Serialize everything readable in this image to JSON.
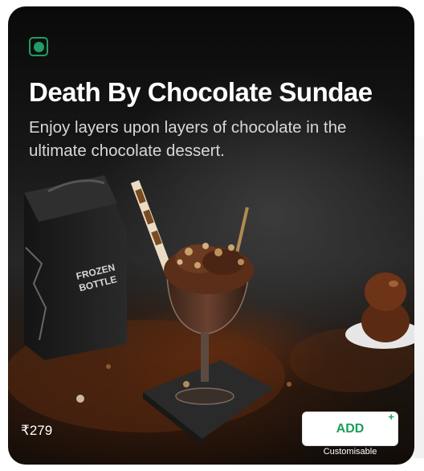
{
  "product": {
    "title": "Death By Chocolate Sundae",
    "description": "Enjoy layers upon layers of chocolate in the ultimate chocolate dessert.",
    "price": "₹279",
    "diet": "veg",
    "box_text_line1": "FROZEN",
    "box_text_line2": "BOTTLE"
  },
  "actions": {
    "add_label": "ADD",
    "plus_symbol": "+",
    "customisable_label": "Customisable"
  },
  "colors": {
    "veg_green": "#1f9d63",
    "add_green": "#1b9f5a"
  },
  "icons": {
    "veg": "veg-indicator-icon",
    "plus": "plus-icon"
  }
}
